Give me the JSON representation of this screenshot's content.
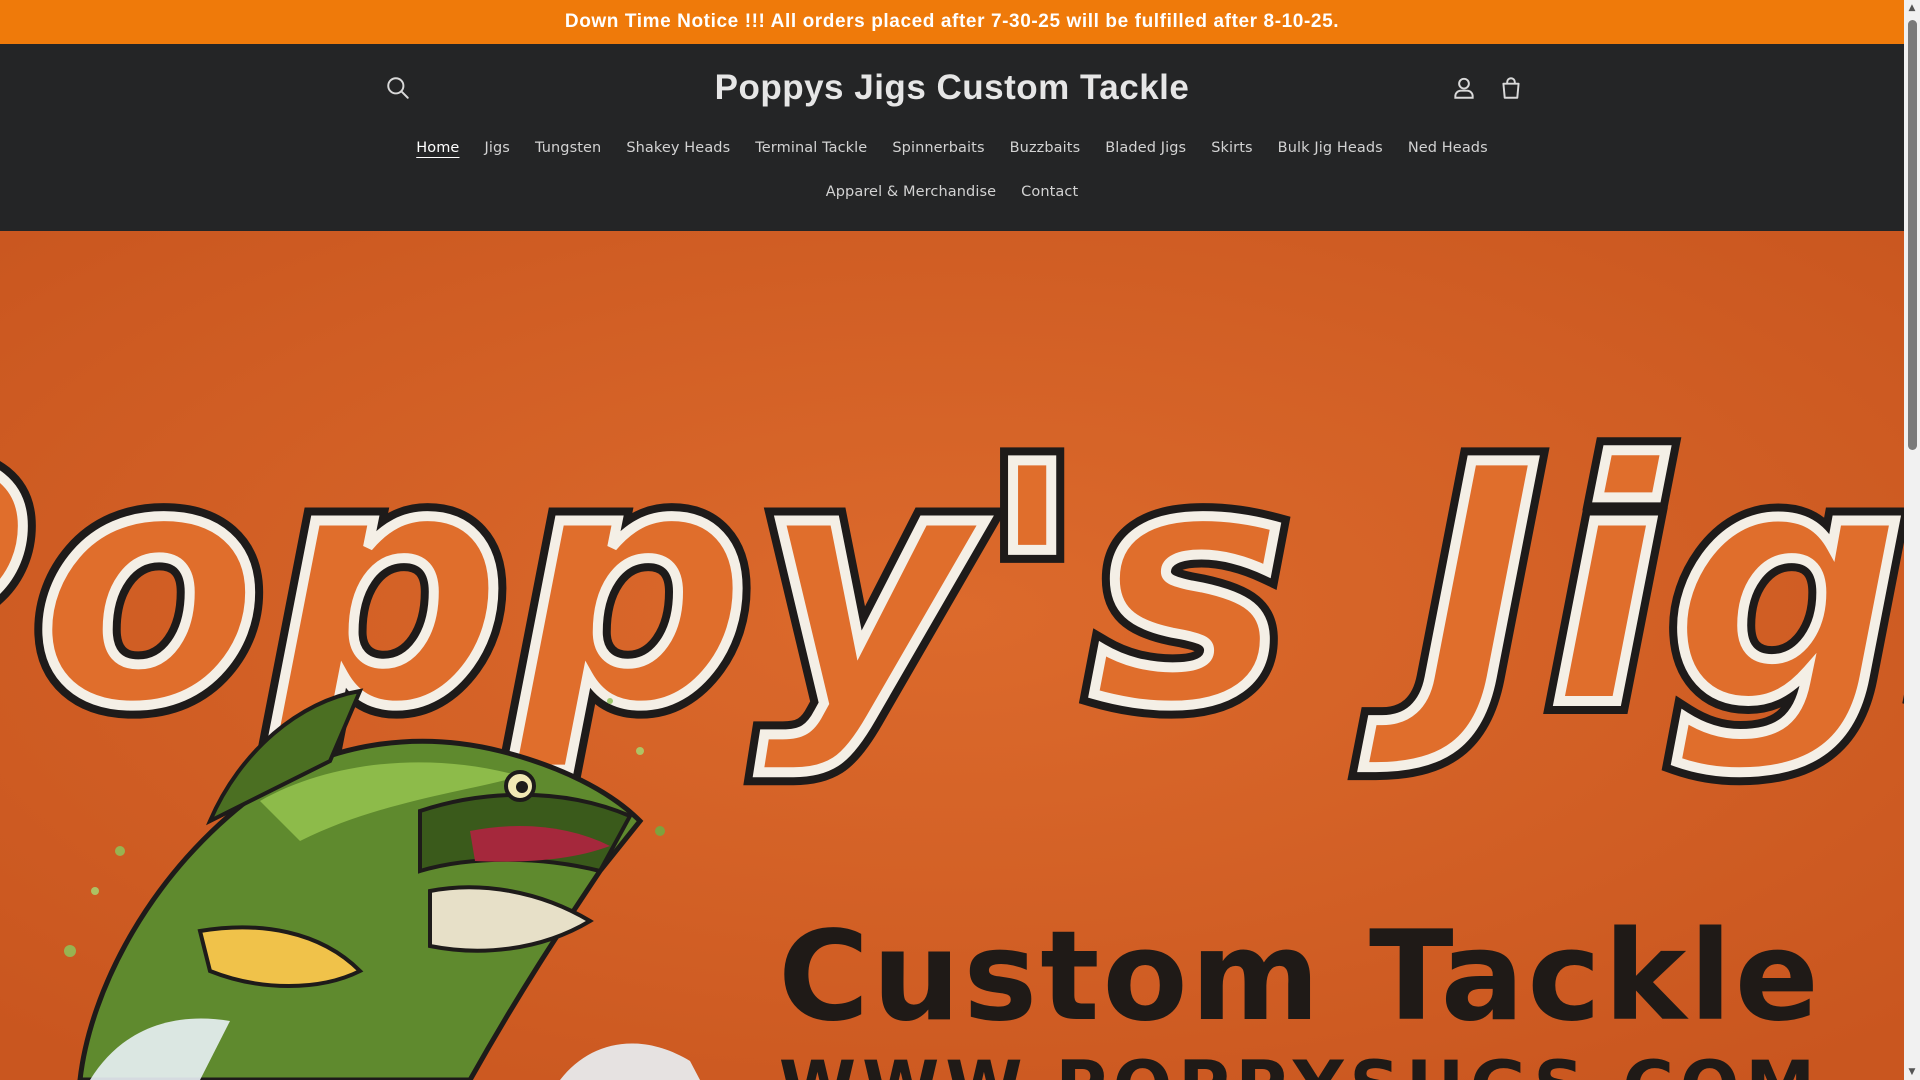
{
  "announcement": {
    "text": "Down Time Notice !!! All orders placed after 7-30-25 will be fulfilled after 8-10-25."
  },
  "header": {
    "site_title": "Poppys Jigs Custom Tackle",
    "icons": {
      "search": "search-icon",
      "account": "account-icon",
      "cart": "cart-icon"
    }
  },
  "nav": {
    "row1": [
      {
        "label": "Home",
        "active": true
      },
      {
        "label": "Jigs"
      },
      {
        "label": "Tungsten"
      },
      {
        "label": "Shakey Heads"
      },
      {
        "label": "Terminal Tackle"
      },
      {
        "label": "Spinnerbaits"
      },
      {
        "label": "Buzzbaits"
      },
      {
        "label": "Bladed Jigs"
      },
      {
        "label": "Skirts"
      },
      {
        "label": "Bulk Jig Heads"
      },
      {
        "label": "Ned Heads"
      }
    ],
    "row2": [
      {
        "label": "Apparel & Merchandise"
      },
      {
        "label": "Contact"
      }
    ]
  },
  "hero": {
    "logo_line1": "Poppy's Jigs",
    "logo_line2": "Custom Tackle",
    "logo_line3": "WWW.POPPYSJIGS.COM"
  },
  "colors": {
    "announcement_bg": "#ef7a0a",
    "header_bg": "#242526",
    "hero_bg": "#d8652a"
  }
}
